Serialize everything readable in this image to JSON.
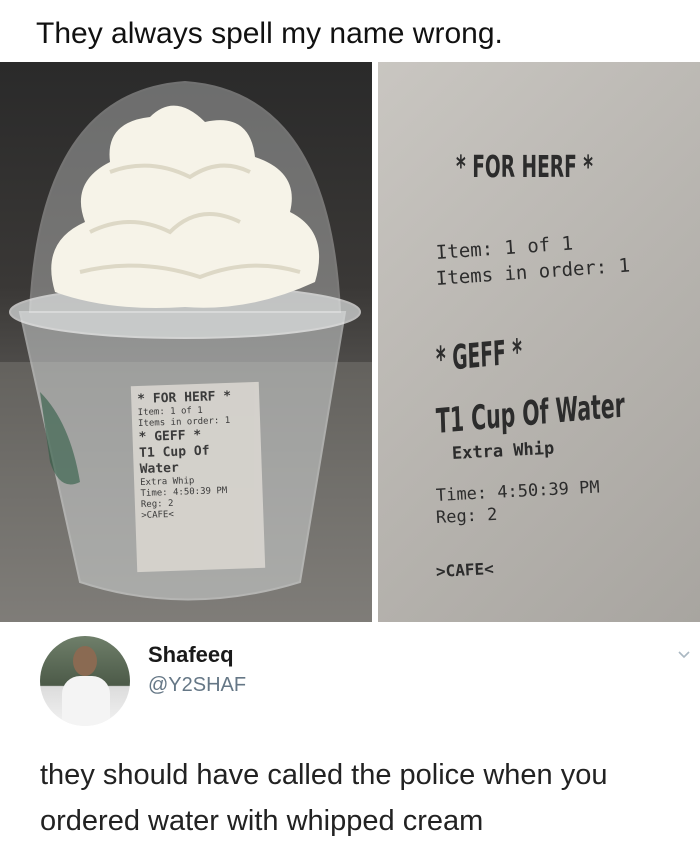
{
  "top_caption": "They always spell my name wrong.",
  "photo_left": {
    "label": {
      "header": "* FOR HERF *",
      "item_line": "Item: 1 of 1",
      "items_line": "Items in order: 1",
      "name": "* GEFF *",
      "drink": "T1 Cup Of Water",
      "modifier": "Extra Whip",
      "time_line": "Time: 4:50:39 PM",
      "reg_line": "Reg: 2",
      "footer": ">CAFE<"
    }
  },
  "photo_right": {
    "label": {
      "header": "* FOR HERF *",
      "item_line": "Item:  1 of 1",
      "items_line": "Items in order: 1",
      "name": "* GEFF *",
      "drink": "T1 Cup Of Water",
      "modifier": "Extra Whip",
      "time_line": "Time:  4:50:39 PM",
      "reg_line": "Reg:   2",
      "footer": ">CAFE<"
    }
  },
  "tweet": {
    "display_name": "Shafeeq",
    "handle": "@Y2SHAF",
    "text": "they should have called the police when you ordered water with whipped cream",
    "icons": {
      "menu": "chevron-down-icon",
      "avatar": "profile-photo"
    },
    "colors": {
      "handle": "#657786",
      "text": "#222222"
    }
  }
}
